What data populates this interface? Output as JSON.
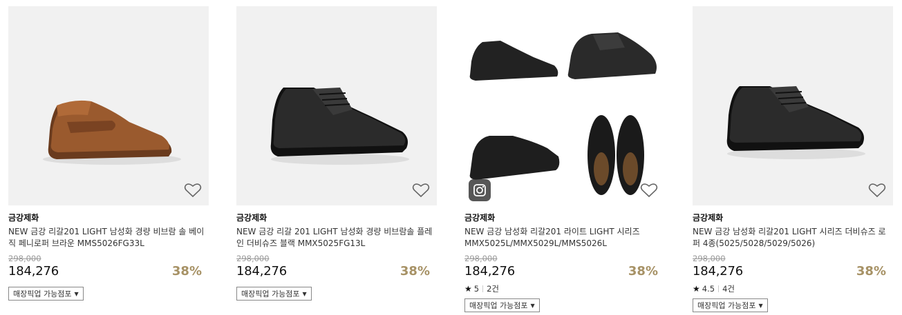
{
  "products": [
    {
      "brand": "금강제화",
      "title": "NEW 금강 리갈201 LIGHT 남성화 경량 비브람 솔 베이직 페니로퍼 브라운 MMS5026FG33L",
      "original_price": "298,000",
      "price": "184,276",
      "discount": "38%",
      "pickup_label": "매장픽업 가능점포"
    },
    {
      "brand": "금강제화",
      "title": "NEW 금강 리갈 201 LIGHT 남성화 경량 비브람솔 플레인 더비슈즈 블랙 MMX5025FG13L",
      "original_price": "298,000",
      "price": "184,276",
      "discount": "38%",
      "pickup_label": "매장픽업 가능점포"
    },
    {
      "brand": "금강제화",
      "title": "NEW 금강 남성화 리갈201 라이트 LIGHT 시리즈 MMX5025L/MMX5029L/MMS5026L",
      "original_price": "298,000",
      "price": "184,276",
      "discount": "38%",
      "rating": "5",
      "review_count": "2건",
      "pickup_label": "매장픽업 가능점포"
    },
    {
      "brand": "금강제화",
      "title": "NEW 금강 남성화 리갈201 LIGHT 시리즈 더비슈즈 로퍼 4종(5025/5028/5029/5026)",
      "original_price": "298,000",
      "price": "184,276",
      "discount": "38%",
      "rating": "4.5",
      "review_count": "4건",
      "pickup_label": "매장픽업 가능점포"
    }
  ],
  "icons": {
    "wishlist": "heart-outline-icon",
    "instagram": "instagram-icon",
    "star": "star-icon",
    "dropdown": "caret-down-icon"
  },
  "colors": {
    "discount": "#a79266",
    "original_price": "#999999",
    "thumb_bg": "#f1f1f1"
  }
}
